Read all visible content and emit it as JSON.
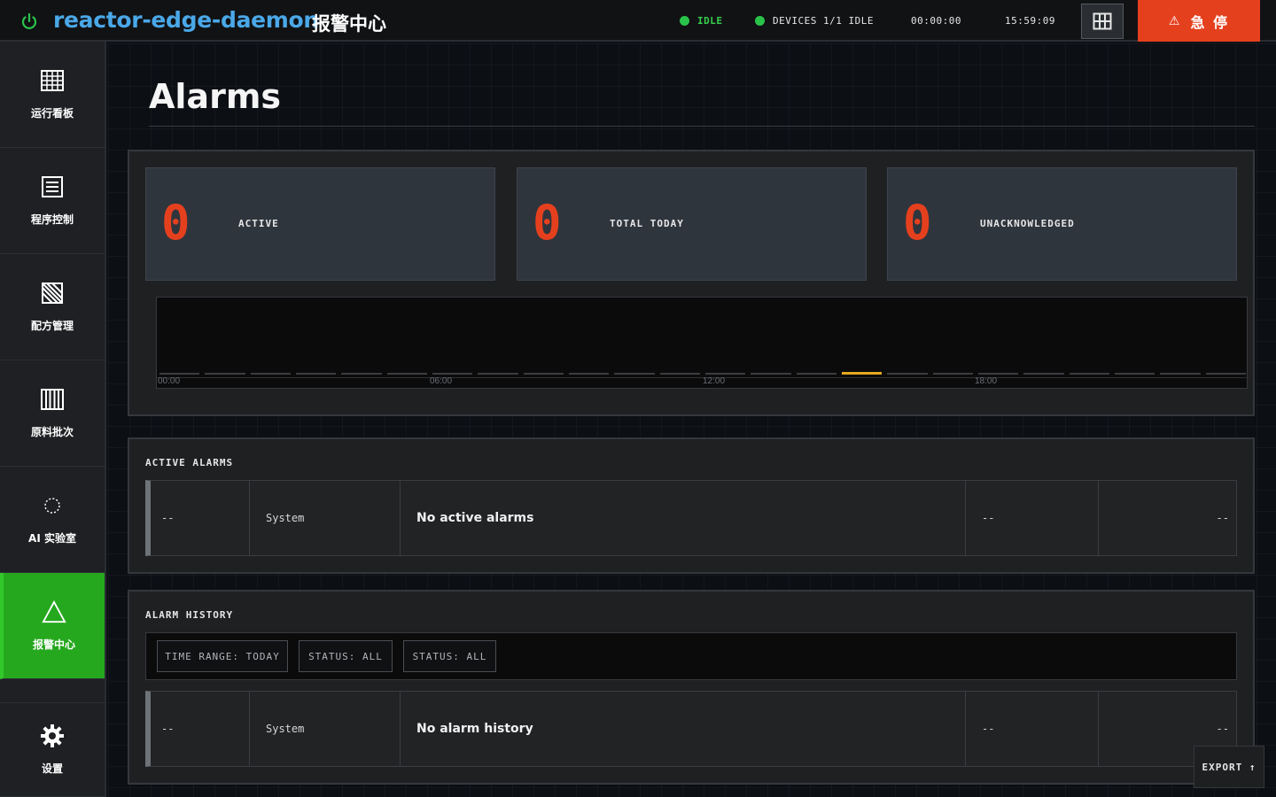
{
  "header": {
    "app_name": "reactor-edge-daemon",
    "page_name": "报警中心",
    "run_state": "IDLE",
    "devices_status": "DEVICES 1/1 IDLE",
    "elapsed": "00:00:00",
    "clock": "15:59:09",
    "estop_label": "急 停",
    "estop_color": "#e5401e",
    "accent_green": "#2ac34a"
  },
  "sidebar": {
    "items": [
      {
        "label": "运行看板",
        "icon": "grid-icon"
      },
      {
        "label": "程序控制",
        "icon": "list-icon"
      },
      {
        "label": "配方管理",
        "icon": "hatched-square-icon"
      },
      {
        "label": "原料批次",
        "icon": "barcode-icon"
      },
      {
        "label": "AI 实验室",
        "icon": "dotted-circle-icon"
      },
      {
        "label": "报警中心",
        "icon": "warning-triangle-icon",
        "active": true
      },
      {
        "label": "设置",
        "icon": "gear-icon"
      }
    ]
  },
  "main": {
    "title": "Alarms",
    "stats": [
      {
        "value": "0",
        "label": "ACTIVE"
      },
      {
        "value": "0",
        "label": "TOTAL TODAY"
      },
      {
        "value": "0",
        "label": "UNACKNOWLEDGED"
      }
    ],
    "timeline": {
      "ticks": [
        "00:00",
        "06:00",
        "12:00",
        "18:00"
      ],
      "highlight_color": "#e5a91e"
    },
    "active_alarms": {
      "title": "ACTIVE ALARMS",
      "row": {
        "time": "--",
        "source": "System",
        "message": "No active alarms",
        "value": "--",
        "status": "--"
      }
    },
    "alarm_history": {
      "title": "ALARM HISTORY",
      "filters": [
        "TIME RANGE: TODAY",
        "STATUS: ALL",
        "STATUS: ALL"
      ],
      "row": {
        "time": "--",
        "source": "System",
        "message": "No alarm history",
        "value": "--",
        "status": "--"
      }
    },
    "export_label": "EXPORT ↑"
  }
}
